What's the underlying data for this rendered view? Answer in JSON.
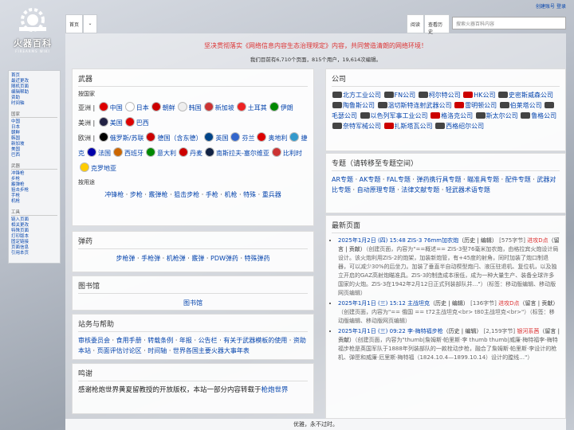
{
  "site": {
    "name": "火器百科",
    "subname": "FIREARMS WIKI"
  },
  "user_links": [
    "创建账号",
    "登录"
  ],
  "tabs": {
    "main": "首页",
    "read": "阅读",
    "history": "查看历史"
  },
  "search": {
    "placeholder": "搜索火器百科内容"
  },
  "sidebar": {
    "nav": [
      "首页",
      "最近更改",
      "随机页面",
      "编辑帮助",
      "资助",
      "时间轴"
    ],
    "country_head": "国家",
    "countries": [
      "中国",
      "日本",
      "朝鲜",
      "韩国",
      "新加坡",
      "美国",
      "巴西"
    ],
    "weapon_head": "武器",
    "weapons": [
      "冲锋枪",
      "步枪",
      "霰弹枪",
      "狙击步枪",
      "手枪",
      "机枪"
    ],
    "tools_head": "工具",
    "tools": [
      "链入页面",
      "相关更改",
      "特殊页面",
      "打印版本",
      "固定链接",
      "页面信息",
      "引用本页"
    ]
  },
  "notice": "坚决贯彻落实《网络信息内容生态治理规定》内容，共同营造清朗的网络环境！",
  "stats": "我们目前有6,710个页面，815个用户，19,614次编辑。",
  "weapons_box": {
    "title": "武器",
    "by_country": "按国家",
    "asia_label": "亚洲",
    "asia": [
      "中国",
      "日本",
      "朝鲜",
      "韩国",
      "新加坡",
      "土耳其",
      "伊朗"
    ],
    "america_label": "美洲",
    "america": [
      "美国",
      "巴西"
    ],
    "europe_label": "欧洲",
    "europe": [
      "俄罗斯/苏联",
      "德国（含东德）",
      "英国",
      "芬兰",
      "奥地利",
      "捷克",
      "法国",
      "西班牙",
      "意大利",
      "丹麦",
      "南斯拉夫-塞尔维亚",
      "比利时",
      "克罗地亚"
    ],
    "by_use": "按用途",
    "uses": [
      "冲锋枪",
      "步枪",
      "霰弹枪",
      "狙击步枪",
      "手枪",
      "机枪",
      "特殊",
      "重兵器"
    ]
  },
  "ammo_box": {
    "title": "弹药",
    "items": [
      "步枪弹",
      "手枪弹",
      "机枪弹",
      "霰弹",
      "PDW弹药",
      "特殊弹药"
    ]
  },
  "library_box": {
    "title": "图书馆",
    "link": "图书馆"
  },
  "help_box": {
    "title": "站务与帮助",
    "items": [
      "审核委员会",
      "食用手册",
      "转载条例",
      "年报",
      "公告栏",
      "有关于武器模板的使用",
      "资助本站",
      "页面评估讨论区",
      "时间轴",
      "世界各国主要火器大事年表"
    ]
  },
  "thanks_box": {
    "title": "鸣谢",
    "text": "感谢枪炮世界黄夏留教授的开放版权，本站一部分内容转载于",
    "link": "枪炮世界"
  },
  "companies_box": {
    "title": "公司",
    "items": [
      "北方工业公司",
      "FN公司",
      "柯尔特公司",
      "HK公司",
      "史密斯威森公司",
      "陶鲁斯公司",
      "温切斯特连射武器公司",
      "雷明顿公司",
      "伯莱塔公司",
      "毛瑟公司",
      "以色列军事工业公司",
      "格洛克公司",
      "斯太尔公司",
      "鲁格公司",
      "奈特军械公司",
      "扎斯塔瓦公司",
      "西格绍尔公司"
    ]
  },
  "topics_box": {
    "title": "专题（请转移至专题空间）",
    "items": [
      "AR专题",
      "AK专题",
      "FAL专题",
      "弹药携行具专题",
      "瞄准具专题",
      "配件专题",
      "武器对比专题",
      "自动原理专题",
      "法律文献专题",
      "轻武器术语专题"
    ]
  },
  "recent_box": {
    "title": "最新页面",
    "items": [
      {
        "date": "2025年1月2日 (四) 15:48",
        "page": "ZIS-3 76mm加农炮",
        "meta": "（历史 | 编辑）",
        "size": "[575字节]",
        "user": "进攻D点",
        "ulinks": "（留言 | 贡献）",
        "summary": "（创建页面，内容为\"==概述== ZIS-3型76毫米加农炮，由格拉宾火炮设计局设计。该火炮利用ZIS-2的炮架，加装新炮管，有+45度的射角，同时加装了炮口制退器，可以减少30%的后坐力。加装了垂直半自动楔型炮闩、液压驻退机、复位机，以及独立开启的GAZ高射炮瞄准具。ZIS-3的制造成本很低，成为一种大量生产、装备全球许多国家的火炮。ZIS-3在1942年2月12日正式列装部队并…\"）（标签：移动版编辑、移动版网页编辑）"
      },
      {
        "date": "2025年1月1日 (三) 15:12",
        "page": "主战坦克",
        "meta": "（历史 | 编辑）",
        "size": "[136字节]",
        "user": "进攻D点",
        "ulinks": "（留言 | 贡献）",
        "summary": "（创建页面，内容为\"== 俄国 == t72主战坦克<br> t80主战坦克<br>\"）（标签：移动版编辑、移动版网页编辑）"
      },
      {
        "date": "2025年1月1日 (三) 09:22",
        "page": "李-梅特福步枪",
        "meta": "（历史 | 编辑）",
        "size": "[2,159字节]",
        "user": "银河系茜",
        "ulinks": "（留言 | 贡献）",
        "summary": "（创建页面，内容为\"thumb|詹姆斯·帕里斯·李 thumb thumb|威廉·梅特福李-梅特福步枪是英国军队于1888年列装部队的一款栓动步枪，融合了詹姆斯·帕里斯·李设计的枪机、弹匣和威廉·厄里斯·梅特福（1824.10.4—1899.10.14）设计的膛线…\"）"
      }
    ]
  },
  "footer": "优雅，永不过时。"
}
